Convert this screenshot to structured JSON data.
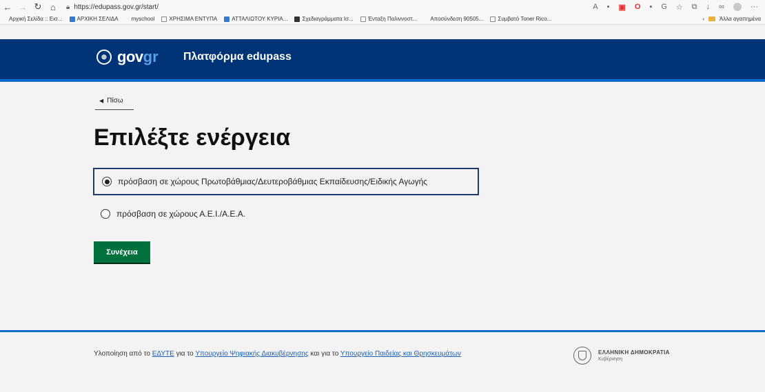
{
  "browser": {
    "url": "https://edupass.gov.gr/start/",
    "back_icon": "arrow-left-icon",
    "forward_icon": "arrow-right-icon",
    "reload_icon": "reload-icon",
    "home_icon": "home-icon",
    "more_label": "···"
  },
  "bookmarks": {
    "items": [
      "Αρχική Σελίδα :: Εισ...",
      "ΑΡΧΙΚΗ ΣΕΛΙΔΑ",
      "myschool",
      "ΧΡΗΣΙΜΑ ΕΝΤΥΠΑ",
      "ΑΤΤΑΛΙΩΤΟΥ ΚΥΡΙΑ...",
      "Σχεδιαγράμματα Ισ...",
      "Ένταξη Παλιννοστ...",
      "Αποσύνδεση 90505...",
      "Συμβατό Toner Rico..."
    ],
    "other_label": "Άλλα αγαπημένα"
  },
  "header": {
    "logo_gov": "gov",
    "logo_gr": "gr",
    "platform_title": "Πλατφόρμα edupass"
  },
  "main": {
    "back_label": "Πίσω",
    "title": "Επιλέξτε ενέργεια",
    "options": [
      {
        "label": "πρόσβαση σε χώρους Πρωτοβάθμιας/Δευτεροβάθμιας Εκπαίδευσης/Ειδικής Αγωγής",
        "selected": true
      },
      {
        "label": "πρόσβαση σε χώρους Α.Ε.Ι./Α.Ε.Α.",
        "selected": false
      }
    ],
    "continue_label": "Συνέχεια"
  },
  "footer": {
    "text_1": "Υλοποίηση από το ",
    "link_edyte": "ΕΔΥΤΕ",
    "text_2": " για το ",
    "link_ministry_digital": "Υπουργείο Ψηφιακής Διακυβέρνησης",
    "text_3": " και για το ",
    "link_ministry_education": "Υπουργείο Παιδείας και Θρησκευμάτων",
    "gov_name": "ΕΛΛΗΝΙΚΗ ΔΗΜΟΚΡΑΤΙΑ",
    "gov_sub": "Κυβέρνηση"
  },
  "colors": {
    "header_bg": "#003476",
    "accent_blue": "#0d6bcc",
    "button_green": "#00703c"
  }
}
